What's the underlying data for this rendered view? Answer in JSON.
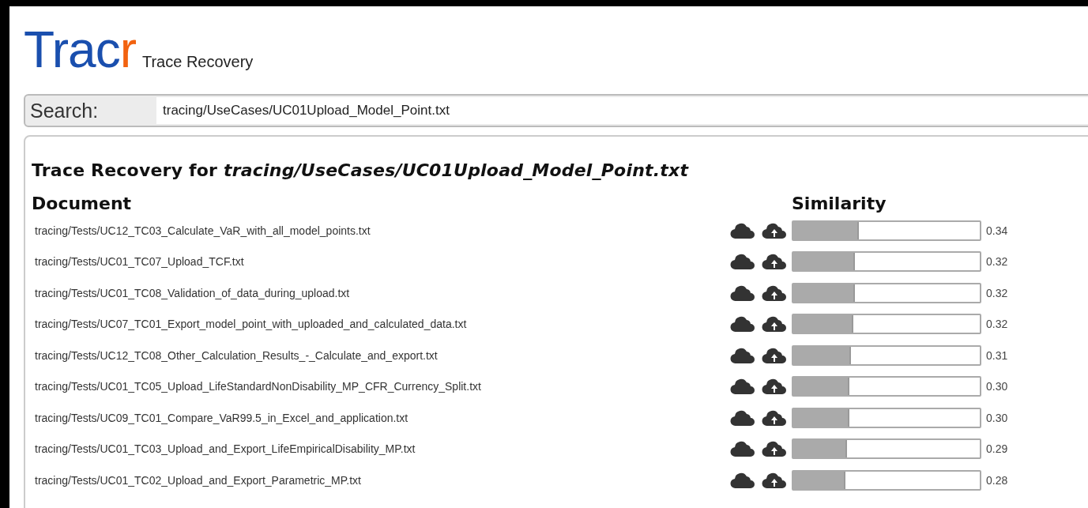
{
  "logo": {
    "text": "Trac",
    "accent": "r",
    "tagline": "Trace Recovery"
  },
  "search": {
    "label": "Search:",
    "value": "tracing/UseCases/UC01Upload_Model_Point.txt"
  },
  "results": {
    "heading": "Trace Recovery for *tracing/UseCases/UC01Upload_Model_Point.txt*",
    "columns": [
      "Document",
      "Similarity"
    ],
    "rows": [
      {
        "document": "tracing/Tests/UC12_TC03_Calculate_VaR_with_all_model_points.txt",
        "level": 0.35,
        "value": "0.34"
      },
      {
        "document": "tracing/Tests/UC01_TC07_Upload_TCF.txt",
        "level": 0.33,
        "value": "0.32"
      },
      {
        "document": "tracing/Tests/UC01_TC08_Validation_of_data_during_upload.txt",
        "level": 0.33,
        "value": "0.32"
      },
      {
        "document": "tracing/Tests/UC07_TC01_Export_model_point_with_uploaded_and_calculated_data.txt",
        "level": 0.32,
        "value": "0.32"
      },
      {
        "document": "tracing/Tests/UC12_TC08_Other_Calculation_Results_-_Calculate_and_export.txt",
        "level": 0.31,
        "value": "0.31"
      },
      {
        "document": "tracing/Tests/UC01_TC05_Upload_LifeStandardNonDisability_MP_CFR_Currency_Split.txt",
        "level": 0.3,
        "value": "0.30"
      },
      {
        "document": "tracing/Tests/UC09_TC01_Compare_VaR99.5_in_Excel_and_application.txt",
        "level": 0.3,
        "value": "0.30"
      },
      {
        "document": "tracing/Tests/UC01_TC03_Upload_and_Export_LifeEmpiricalDisability_MP.txt",
        "level": 0.29,
        "value": "0.29"
      },
      {
        "document": "tracing/Tests/UC01_TC02_Upload_and_Export_Parametric_MP.txt",
        "level": 0.28,
        "value": "0.28"
      }
    ]
  }
}
